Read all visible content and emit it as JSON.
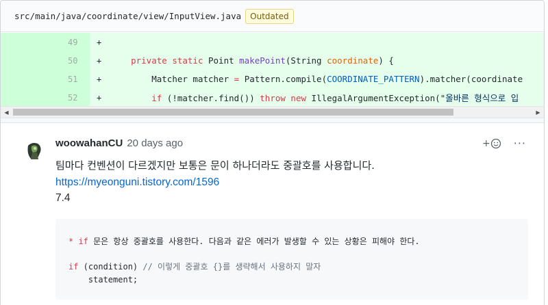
{
  "file": {
    "path": "src/main/java/coordinate/view/InputView.java",
    "badge": "Outdated"
  },
  "diff": {
    "lines": [
      {
        "number": "49",
        "marker": "+"
      },
      {
        "number": "50",
        "marker": "+"
      },
      {
        "number": "51",
        "marker": "+"
      },
      {
        "number": "52",
        "marker": "+"
      }
    ],
    "code": {
      "l50_indent": "    ",
      "l50_kw": "private static",
      "l50_type": " Point ",
      "l50_fn": "makePoint",
      "l50_open": "(String ",
      "l50_var": "coordinate",
      "l50_close": ") {",
      "l51_indent": "        ",
      "l51_a": "Matcher matcher ",
      "l51_eq": "=",
      "l51_b": " Pattern.compile(",
      "l51_const": "COORDINATE_PATTERN",
      "l51_c": ").matcher(coordinate",
      "l52_indent": "        ",
      "l52_if": "if",
      "l52_a": " (!matcher.find()) ",
      "l52_throw": "throw new",
      "l52_b": " IllegalArgumentException(",
      "l52_str": "\"올바른 형식으로 입"
    },
    "colors": {
      "added_bg": "#e6ffec",
      "added_gutter": "#cdffd8"
    }
  },
  "comment": {
    "author": "woowahanCU",
    "time": "20 days ago",
    "text": "팀마다 컨벤션이 다르겠지만 보통은 문이 하나더라도 중괄호를 사용합니다.",
    "link": "https://myeonguni.tistory.com/1596",
    "version": "7.4",
    "reaction_icon": "smiley-add-icon",
    "reaction_plus": "+",
    "more_label": "···",
    "code_block": {
      "line1_star": "* ",
      "line1_if": "if",
      "line1_rest": " 문은 항상 중괄호를 사용한다. 다음과 같은 에러가 발생할 수 있는 상황은 피해야 한다.",
      "line2_if": "if",
      "line2_cond": " (condition) ",
      "line2_comment": "// 이렇게 중괄호 {}를 생략해서 사용하지 말자",
      "line3": "    statement;"
    }
  }
}
